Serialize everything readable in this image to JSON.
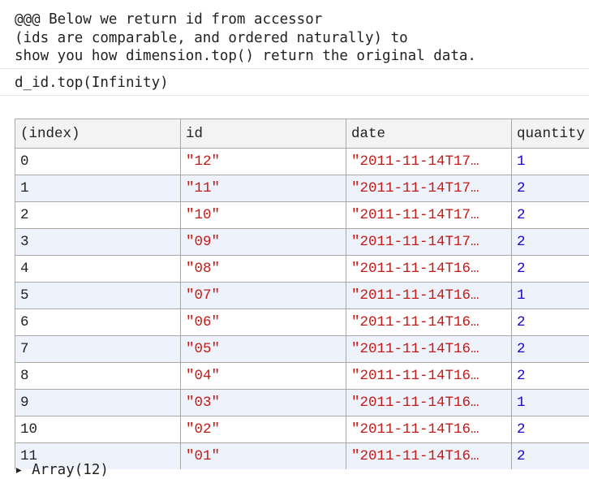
{
  "log": {
    "lines": [
      "@@@ Below we return id from accessor",
      "(ids are comparable, and ordered naturally) to",
      "show you how dimension.top() return the original data."
    ]
  },
  "expression": "d_id.top(Infinity)",
  "table": {
    "headers": [
      "(index)",
      "id",
      "date",
      "quantity"
    ],
    "rows": [
      {
        "index": "0",
        "id": "\"12\"",
        "date": "\"2011-11-14T17…",
        "quantity": "1"
      },
      {
        "index": "1",
        "id": "\"11\"",
        "date": "\"2011-11-14T17…",
        "quantity": "2"
      },
      {
        "index": "2",
        "id": "\"10\"",
        "date": "\"2011-11-14T17…",
        "quantity": "2"
      },
      {
        "index": "3",
        "id": "\"09\"",
        "date": "\"2011-11-14T17…",
        "quantity": "2"
      },
      {
        "index": "4",
        "id": "\"08\"",
        "date": "\"2011-11-14T16…",
        "quantity": "2"
      },
      {
        "index": "5",
        "id": "\"07\"",
        "date": "\"2011-11-14T16…",
        "quantity": "1"
      },
      {
        "index": "6",
        "id": "\"06\"",
        "date": "\"2011-11-14T16…",
        "quantity": "2"
      },
      {
        "index": "7",
        "id": "\"05\"",
        "date": "\"2011-11-14T16…",
        "quantity": "2"
      },
      {
        "index": "8",
        "id": "\"04\"",
        "date": "\"2011-11-14T16…",
        "quantity": "2"
      },
      {
        "index": "9",
        "id": "\"03\"",
        "date": "\"2011-11-14T16…",
        "quantity": "1"
      },
      {
        "index": "10",
        "id": "\"02\"",
        "date": "\"2011-11-14T16…",
        "quantity": "2"
      },
      {
        "index": "11",
        "id": "\"01\"",
        "date": "\"2011-11-14T16…",
        "quantity": "2"
      }
    ]
  },
  "footer": "▸ Array(12)",
  "colors": {
    "string": "#c41a16",
    "number": "#1c00cf",
    "header_bg": "#f3f3f3",
    "stripe_bg": "#eef3fb",
    "border": "#a9a9a9"
  }
}
